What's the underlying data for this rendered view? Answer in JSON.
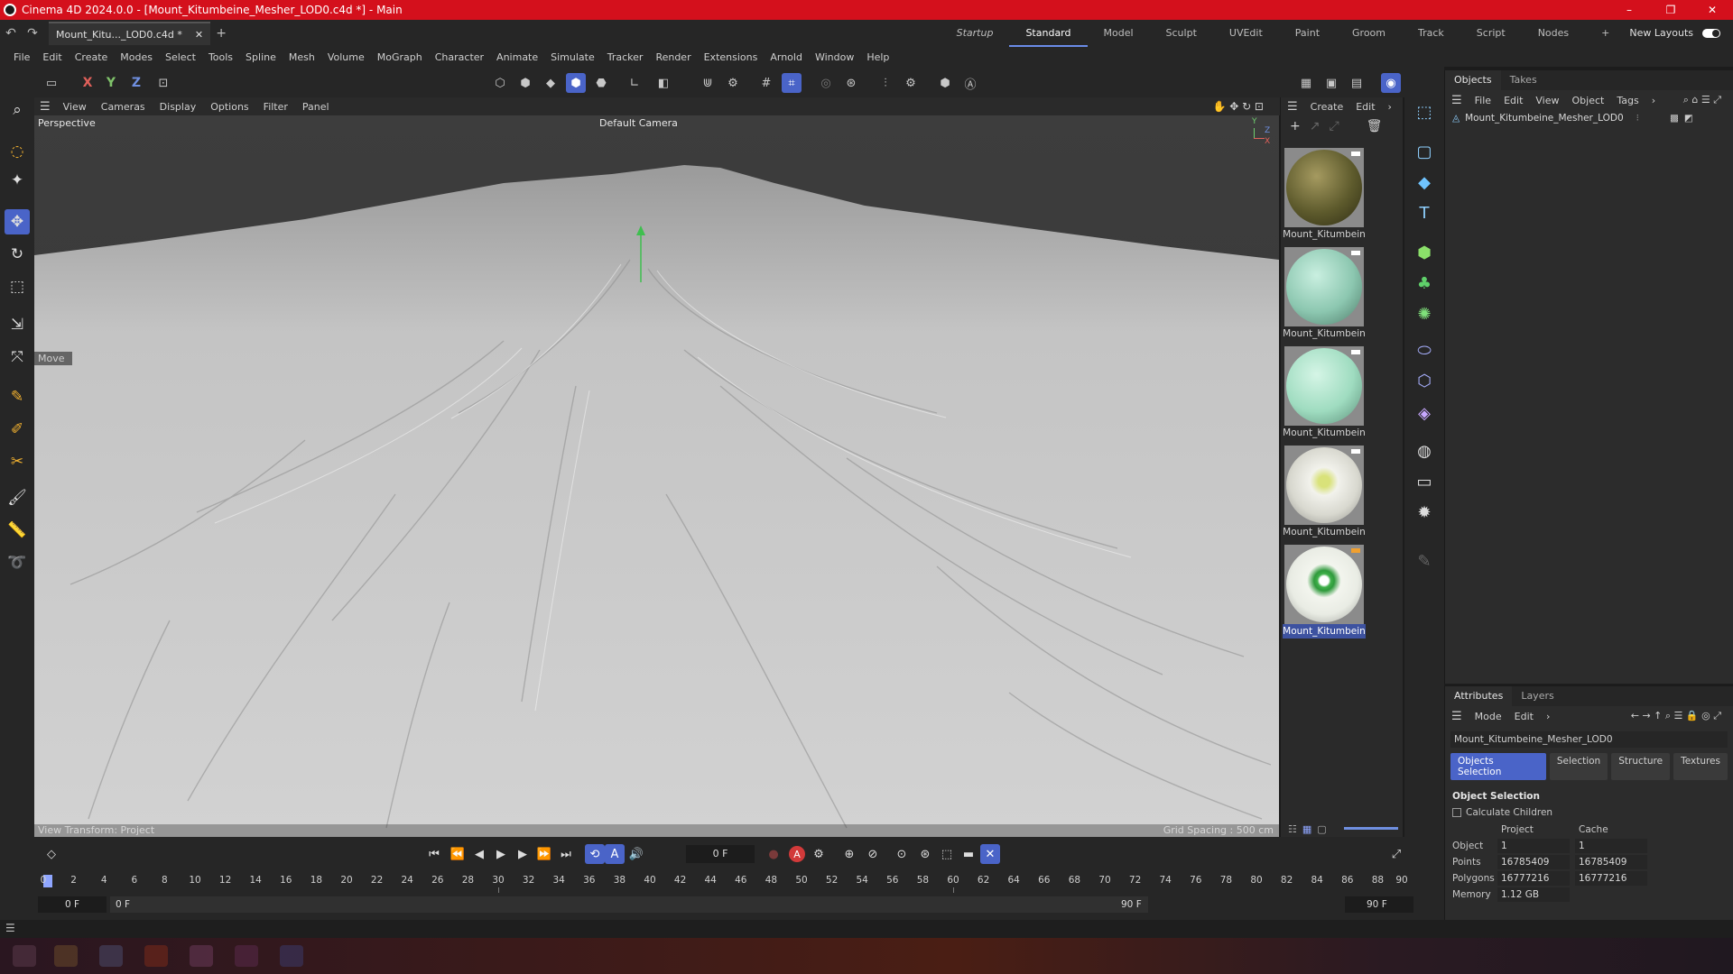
{
  "window": {
    "title": "Cinema 4D 2024.0.0 - [Mount_Kitumbeine_Mesher_LOD0.c4d *] - Main",
    "minimize": "–",
    "maximize": "❐",
    "close": "✕"
  },
  "tabs": {
    "document": "Mount_Kitu..._LOD0.c4d *",
    "close": "✕",
    "add": "+",
    "layouts": [
      "Startup",
      "Standard",
      "Model",
      "Sculpt",
      "UVEdit",
      "Paint",
      "Groom",
      "Track",
      "Script",
      "Nodes"
    ],
    "active_layout": "Standard",
    "add_layout": "+",
    "new_layouts": "New Layouts"
  },
  "menu": [
    "File",
    "Edit",
    "Create",
    "Modes",
    "Select",
    "Tools",
    "Spline",
    "Mesh",
    "Volume",
    "MoGraph",
    "Character",
    "Animate",
    "Simulate",
    "Tracker",
    "Render",
    "Extensions",
    "Arnold",
    "Window",
    "Help"
  ],
  "toolbar": {
    "x": "X",
    "y": "Y",
    "z": "Z"
  },
  "viewport": {
    "menu": [
      "View",
      "Cameras",
      "Display",
      "Options",
      "Filter",
      "Panel"
    ],
    "projection": "Perspective",
    "camera": "Default Camera",
    "tool_hint": "Move",
    "view_transform": "View Transform: Project",
    "grid_spacing": "Grid Spacing : 500 cm",
    "axis_y": "Y",
    "axis_z": "Z",
    "axis_x": "X"
  },
  "materials": {
    "menu": [
      "Create",
      "Edit"
    ],
    "items": [
      {
        "name": "Mount_Kitumbein",
        "color": "#6d6a3a"
      },
      {
        "name": "Mount_Kitumbein",
        "color": "#8cc7b0"
      },
      {
        "name": "Mount_Kitumbein",
        "color": "#9fdcc0"
      },
      {
        "name": "Mount_Kitumbein",
        "color": "#d8d8cf"
      },
      {
        "name": "Mount_Kitumbein",
        "color": "#e9ece4"
      }
    ]
  },
  "objects": {
    "tabs": [
      "Objects",
      "Takes"
    ],
    "menu": [
      "File",
      "Edit",
      "View",
      "Object",
      "Tags"
    ],
    "items": [
      {
        "name": "Mount_Kitumbeine_Mesher_LOD0"
      }
    ]
  },
  "attributes": {
    "tabs": [
      "Attributes",
      "Layers"
    ],
    "menu": [
      "Mode",
      "Edit"
    ],
    "object_name": "Mount_Kitumbeine_Mesher_LOD0",
    "subtabs": [
      "Objects Selection",
      "Selection",
      "Structure",
      "Textures"
    ],
    "section_title": "Object Selection",
    "calculate_children": "Calculate Children",
    "col_project": "Project",
    "col_cache": "Cache",
    "rows": [
      {
        "label": "Object",
        "project": "1",
        "cache": "1"
      },
      {
        "label": "Points",
        "project": "16785409",
        "cache": "16785409"
      },
      {
        "label": "Polygons",
        "project": "16777216",
        "cache": "16777216"
      },
      {
        "label": "Memory",
        "project": "1.12 GB",
        "cache": ""
      }
    ]
  },
  "timeline": {
    "current_frame": "0 F",
    "ticks": [
      "0",
      "2",
      "4",
      "6",
      "8",
      "10",
      "12",
      "14",
      "16",
      "18",
      "20",
      "22",
      "24",
      "26",
      "28",
      "30",
      "32",
      "34",
      "36",
      "38",
      "40",
      "42",
      "44",
      "46",
      "48",
      "50",
      "52",
      "54",
      "56",
      "58",
      "60",
      "62",
      "64",
      "66",
      "68",
      "70",
      "72",
      "74",
      "76",
      "78",
      "80",
      "82",
      "84",
      "86",
      "88",
      "90"
    ],
    "start": "0 F",
    "range_start": "0 F",
    "range_end": "90 F",
    "end": "90 F"
  },
  "colors": {
    "accent": "#4a64c8",
    "titlebar": "#d4101c"
  }
}
